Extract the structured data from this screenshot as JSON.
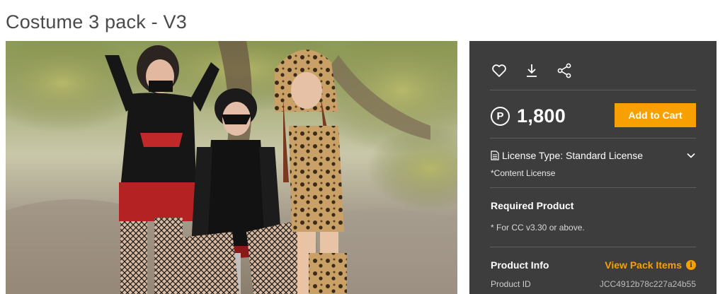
{
  "page": {
    "title": "Costume 3 pack - V3"
  },
  "product_image": {
    "alt_icon": "product-photo",
    "colors": {
      "leaves": "#9aa35a",
      "sky": "#d8dccb",
      "ground": "#b5aca0"
    }
  },
  "actions": {
    "icons": [
      "heart-icon",
      "download-icon",
      "share-icon"
    ]
  },
  "price": {
    "currency_symbol": "P",
    "value": "1,800",
    "add_to_cart_label": "Add to Cart"
  },
  "license": {
    "label": "License Type: Standard License",
    "sub": "*Content License"
  },
  "required_product": {
    "title": "Required Product",
    "note": "* For CC v3.30 or above."
  },
  "product_info": {
    "title": "Product Info",
    "view_pack_label": "View Pack Items",
    "id_label": "Product ID",
    "id_value": "JCC4912b78c227a24b55"
  },
  "colors": {
    "panel_bg": "#3d3d3d",
    "accent": "#f7a000"
  }
}
